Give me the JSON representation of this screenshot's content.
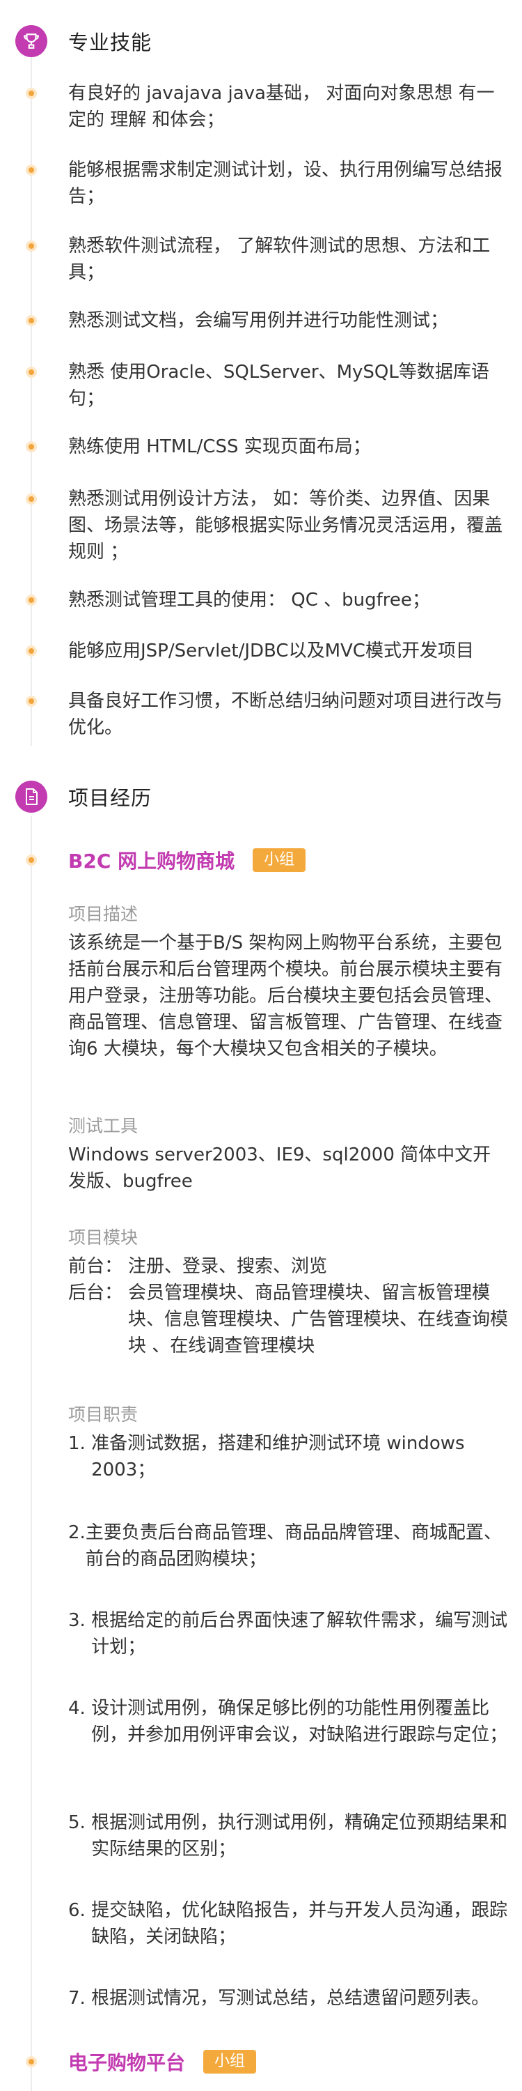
{
  "skills_section": {
    "title": "专业技能",
    "items": [
      "有良好的 javajava java基础， 对面向对象思想 有一定的 理解 和体会；",
      "能够根据需求制定测试计划，设、执行用例编写总结报告；",
      "熟悉软件测试流程， 了解软件测试的思想、方法和工具；",
      "熟悉测试文档，会编写用例并进行功能性测试；",
      "熟悉 使用Oracle、SQLServer、MySQL等数据库语句；",
      "熟练使用 HTML/CSS 实现页面布局；",
      "熟悉测试用例设计方法， 如：等价类、边界值、因果图、场景法等，能够根据实际业务情况灵活运用，覆盖规则 ；",
      "熟悉测试管理工具的使用： QC 、bugfree；",
      "能够应用JSP/Servlet/JDBC以及MVC模式开发项目",
      "具备良好工作习惯，不断总结归纳问题对项目进行改与优化。"
    ]
  },
  "projects_section": {
    "title": "项目经历",
    "projects": [
      {
        "title": "B2C 网上购物商城",
        "badge": "小组",
        "desc_label": "项目描述",
        "desc": "该系统是一个基于B/S 架构网上购物平台系统，主要包括前台展示和后台管理两个模块。前台展示模块主要有用户登录，注册等功能。后台模块主要包括会员管理、商品管理、信息管理、留言板管理、广告管理、在线查询6 大模块，每个大模块又包含相关的子模块。",
        "tools_label": "测试工具",
        "tools": "Windows server2003、IE9、sql2000 简体中文开发版、bugfree",
        "modules_label": "项目模块",
        "modules": [
          {
            "k": "前台：",
            "v": "注册、登录、搜索、浏览"
          },
          {
            "k": "后台：",
            "v": "会员管理模块、商品管理模块、留言板管理模块、信息管理模块、广告管理模块、在线查询模块 、在线调查管理模块"
          }
        ],
        "duties_label": "项目职责",
        "duties": [
          {
            "n": "1. ",
            "t": "准备测试数据，搭建和维护测试环境 windows 2003；"
          },
          {
            "n": "2.",
            "t": "主要负责后台商品管理、商品品牌管理、商城配置、前台的商品团购模块；"
          },
          {
            "n": "3. ",
            "t": "根据给定的前后台界面快速了解软件需求，编写测试计划；"
          },
          {
            "n": "4. ",
            "t": "设计测试用例，确保足够比例的功能性用例覆盖比例，并参加用例评审会议，对缺陷进行跟踪与定位；"
          },
          {
            "n": "5. ",
            "t": "根据测试用例，执行测试用例，精确定位预期结果和实际结果的区别；"
          },
          {
            "n": "6. ",
            "t": "提交缺陷，优化缺陷报告，并与开发人员沟通，跟踪缺陷，关闭缺陷；"
          },
          {
            "n": "7. ",
            "t": "根据测试情况，写测试总结，总结遗留问题列表。"
          }
        ]
      },
      {
        "title": "电子购物平台",
        "badge": "小组"
      }
    ]
  },
  "colors": {
    "accent": "#c23bb0",
    "badge": "#f4a93d",
    "dot": "#f3a53c",
    "label": "#9a9a9a"
  }
}
